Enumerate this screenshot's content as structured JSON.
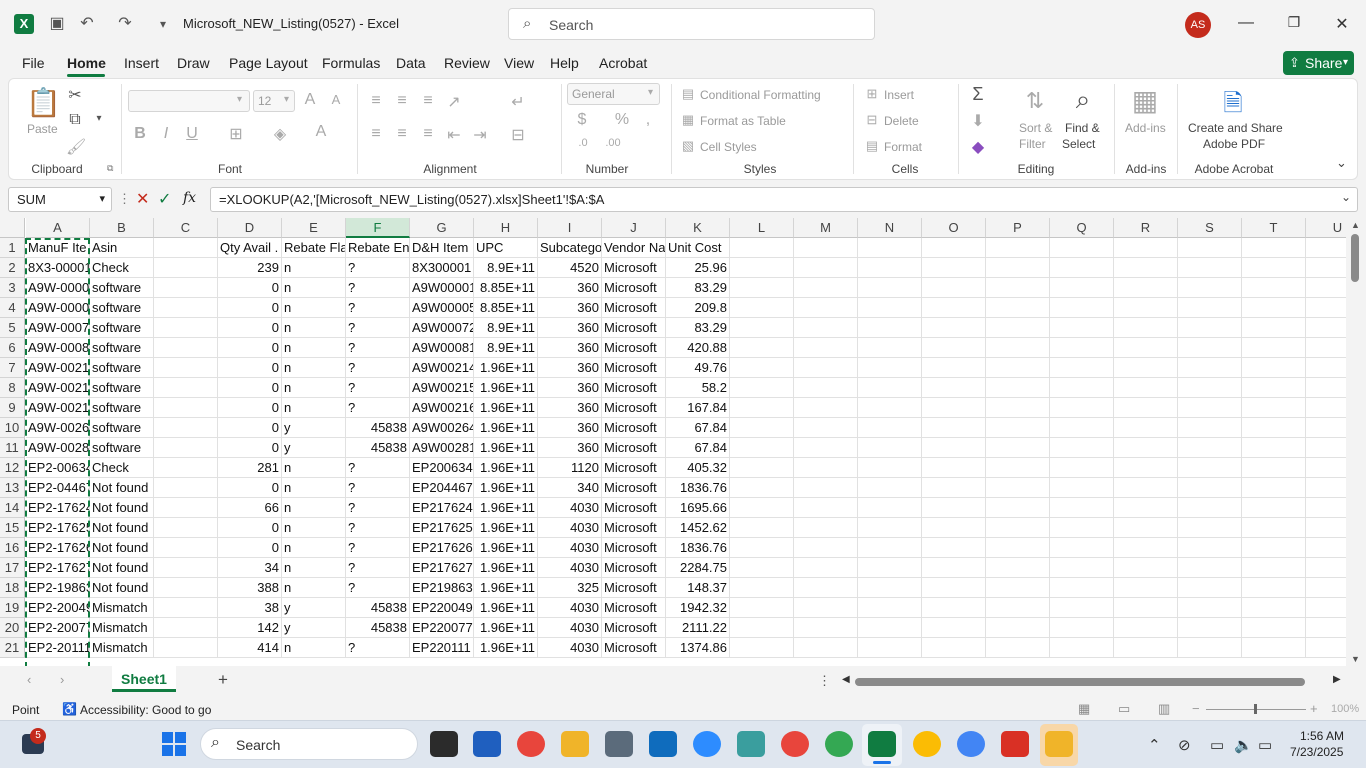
{
  "window": {
    "title": "Microsoft_NEW_Listing(0527)  -  Excel",
    "search_placeholder": "Search",
    "avatar": "AS"
  },
  "menu": [
    "File",
    "Home",
    "Insert",
    "Draw",
    "Page Layout",
    "Formulas",
    "Data",
    "Review",
    "View",
    "Help",
    "Acrobat"
  ],
  "share_label": "Share",
  "ribbon": {
    "clipboard": {
      "paste": "Paste",
      "group": "Clipboard"
    },
    "font": {
      "size": "12",
      "group": "Font",
      "bold": "B",
      "italic": "I",
      "underline": "U"
    },
    "alignment": {
      "group": "Alignment"
    },
    "number": {
      "format": "General",
      "group": "Number",
      "currency": "$",
      "percent": "%"
    },
    "styles": {
      "conditional": "Conditional Formatting",
      "table": "Format as Table",
      "cell_styles": "Cell Styles",
      "group": "Styles"
    },
    "cells": {
      "insert": "Insert",
      "delete": "Delete",
      "format": "Format",
      "group": "Cells"
    },
    "editing": {
      "sort": "Sort &",
      "filter": "Filter",
      "find": "Find &",
      "select": "Select",
      "group": "Editing"
    },
    "addins": {
      "label": "Add-ins",
      "group": "Add-ins"
    },
    "acrobat": {
      "line1": "Create and Share",
      "line2": "Adobe PDF",
      "group": "Adobe Acrobat"
    }
  },
  "formula_bar": {
    "name_box": "SUM",
    "fx": "fx",
    "formula": "=XLOOKUP(A2,'[Microsoft_NEW_Listing(0527).xlsx]Sheet1'!$A:$A"
  },
  "columns": [
    "A",
    "B",
    "C",
    "D",
    "E",
    "F",
    "G",
    "H",
    "I",
    "J",
    "K",
    "L",
    "M",
    "N",
    "O",
    "P",
    "Q",
    "R",
    "S",
    "T",
    "U"
  ],
  "rows": [
    [
      "ManuF Ite",
      "Asin",
      "",
      "Qty Avail .",
      "Rebate Fla",
      "Rebate En",
      "D&H Item",
      "UPC",
      "Subcatego",
      "Vendor Na",
      "Unit Cost"
    ],
    [
      "8X3-00001",
      "Check",
      "",
      "239",
      "n",
      "?",
      "8X300001",
      "8.9E+11",
      "4520",
      "Microsoft",
      "25.96"
    ],
    [
      "A9W-0000",
      "software",
      "",
      "0",
      "n",
      "?",
      "A9W00001",
      "8.85E+11",
      "360",
      "Microsoft",
      "83.29"
    ],
    [
      "A9W-0000",
      "software",
      "",
      "0",
      "n",
      "?",
      "A9W00005",
      "8.85E+11",
      "360",
      "Microsoft",
      "209.8"
    ],
    [
      "A9W-0007",
      "software",
      "",
      "0",
      "n",
      "?",
      "A9W00072",
      "8.9E+11",
      "360",
      "Microsoft",
      "83.29"
    ],
    [
      "A9W-0008",
      "software",
      "",
      "0",
      "n",
      "?",
      "A9W00081",
      "8.9E+11",
      "360",
      "Microsoft",
      "420.88"
    ],
    [
      "A9W-0021",
      "software",
      "",
      "0",
      "n",
      "?",
      "A9W00214",
      "1.96E+11",
      "360",
      "Microsoft",
      "49.76"
    ],
    [
      "A9W-0021",
      "software",
      "",
      "0",
      "n",
      "?",
      "A9W00215",
      "1.96E+11",
      "360",
      "Microsoft",
      "58.2"
    ],
    [
      "A9W-0021",
      "software",
      "",
      "0",
      "n",
      "?",
      "A9W00216",
      "1.96E+11",
      "360",
      "Microsoft",
      "167.84"
    ],
    [
      "A9W-0026",
      "software",
      "",
      "0",
      "y",
      "45838",
      "A9W00264",
      "1.96E+11",
      "360",
      "Microsoft",
      "67.84"
    ],
    [
      "A9W-0028",
      "software",
      "",
      "0",
      "y",
      "45838",
      "A9W00281",
      "1.96E+11",
      "360",
      "Microsoft",
      "67.84"
    ],
    [
      "EP2-00634",
      "Check",
      "",
      "281",
      "n",
      "?",
      "EP200634",
      "1.96E+11",
      "1120",
      "Microsoft",
      "405.32"
    ],
    [
      "EP2-04467",
      "Not found",
      "",
      "0",
      "n",
      "?",
      "EP204467",
      "1.96E+11",
      "340",
      "Microsoft",
      "1836.76"
    ],
    [
      "EP2-17624",
      "Not found",
      "",
      "66",
      "n",
      "?",
      "EP217624",
      "1.96E+11",
      "4030",
      "Microsoft",
      "1695.66"
    ],
    [
      "EP2-17625",
      "Not found",
      "",
      "0",
      "n",
      "?",
      "EP217625",
      "1.96E+11",
      "4030",
      "Microsoft",
      "1452.62"
    ],
    [
      "EP2-17626",
      "Not found",
      "",
      "0",
      "n",
      "?",
      "EP217626",
      "1.96E+11",
      "4030",
      "Microsoft",
      "1836.76"
    ],
    [
      "EP2-17627",
      "Not found",
      "",
      "34",
      "n",
      "?",
      "EP217627",
      "1.96E+11",
      "4030",
      "Microsoft",
      "2284.75"
    ],
    [
      "EP2-19863",
      "Not found",
      "",
      "388",
      "n",
      "?",
      "EP219863",
      "1.96E+11",
      "325",
      "Microsoft",
      "148.37"
    ],
    [
      "EP2-20049",
      "Mismatch",
      "",
      "38",
      "y",
      "45838",
      "EP220049",
      "1.96E+11",
      "4030",
      "Microsoft",
      "1942.32"
    ],
    [
      "EP2-20077",
      "Mismatch",
      "",
      "142",
      "y",
      "45838",
      "EP220077",
      "1.96E+11",
      "4030",
      "Microsoft",
      "2111.22"
    ],
    [
      "EP2-20111",
      "Mismatch",
      "",
      "414",
      "n",
      "?",
      "EP220111",
      "1.96E+11",
      "4030",
      "Microsoft",
      "1374.86"
    ]
  ],
  "sheet_tab": "Sheet1",
  "status": {
    "mode": "Point",
    "accessibility": "Accessibility: Good to go",
    "zoom": "100%"
  },
  "taskbar": {
    "search": "Search",
    "time": "1:56 AM",
    "date": "7/23/2025",
    "badge": "5"
  }
}
